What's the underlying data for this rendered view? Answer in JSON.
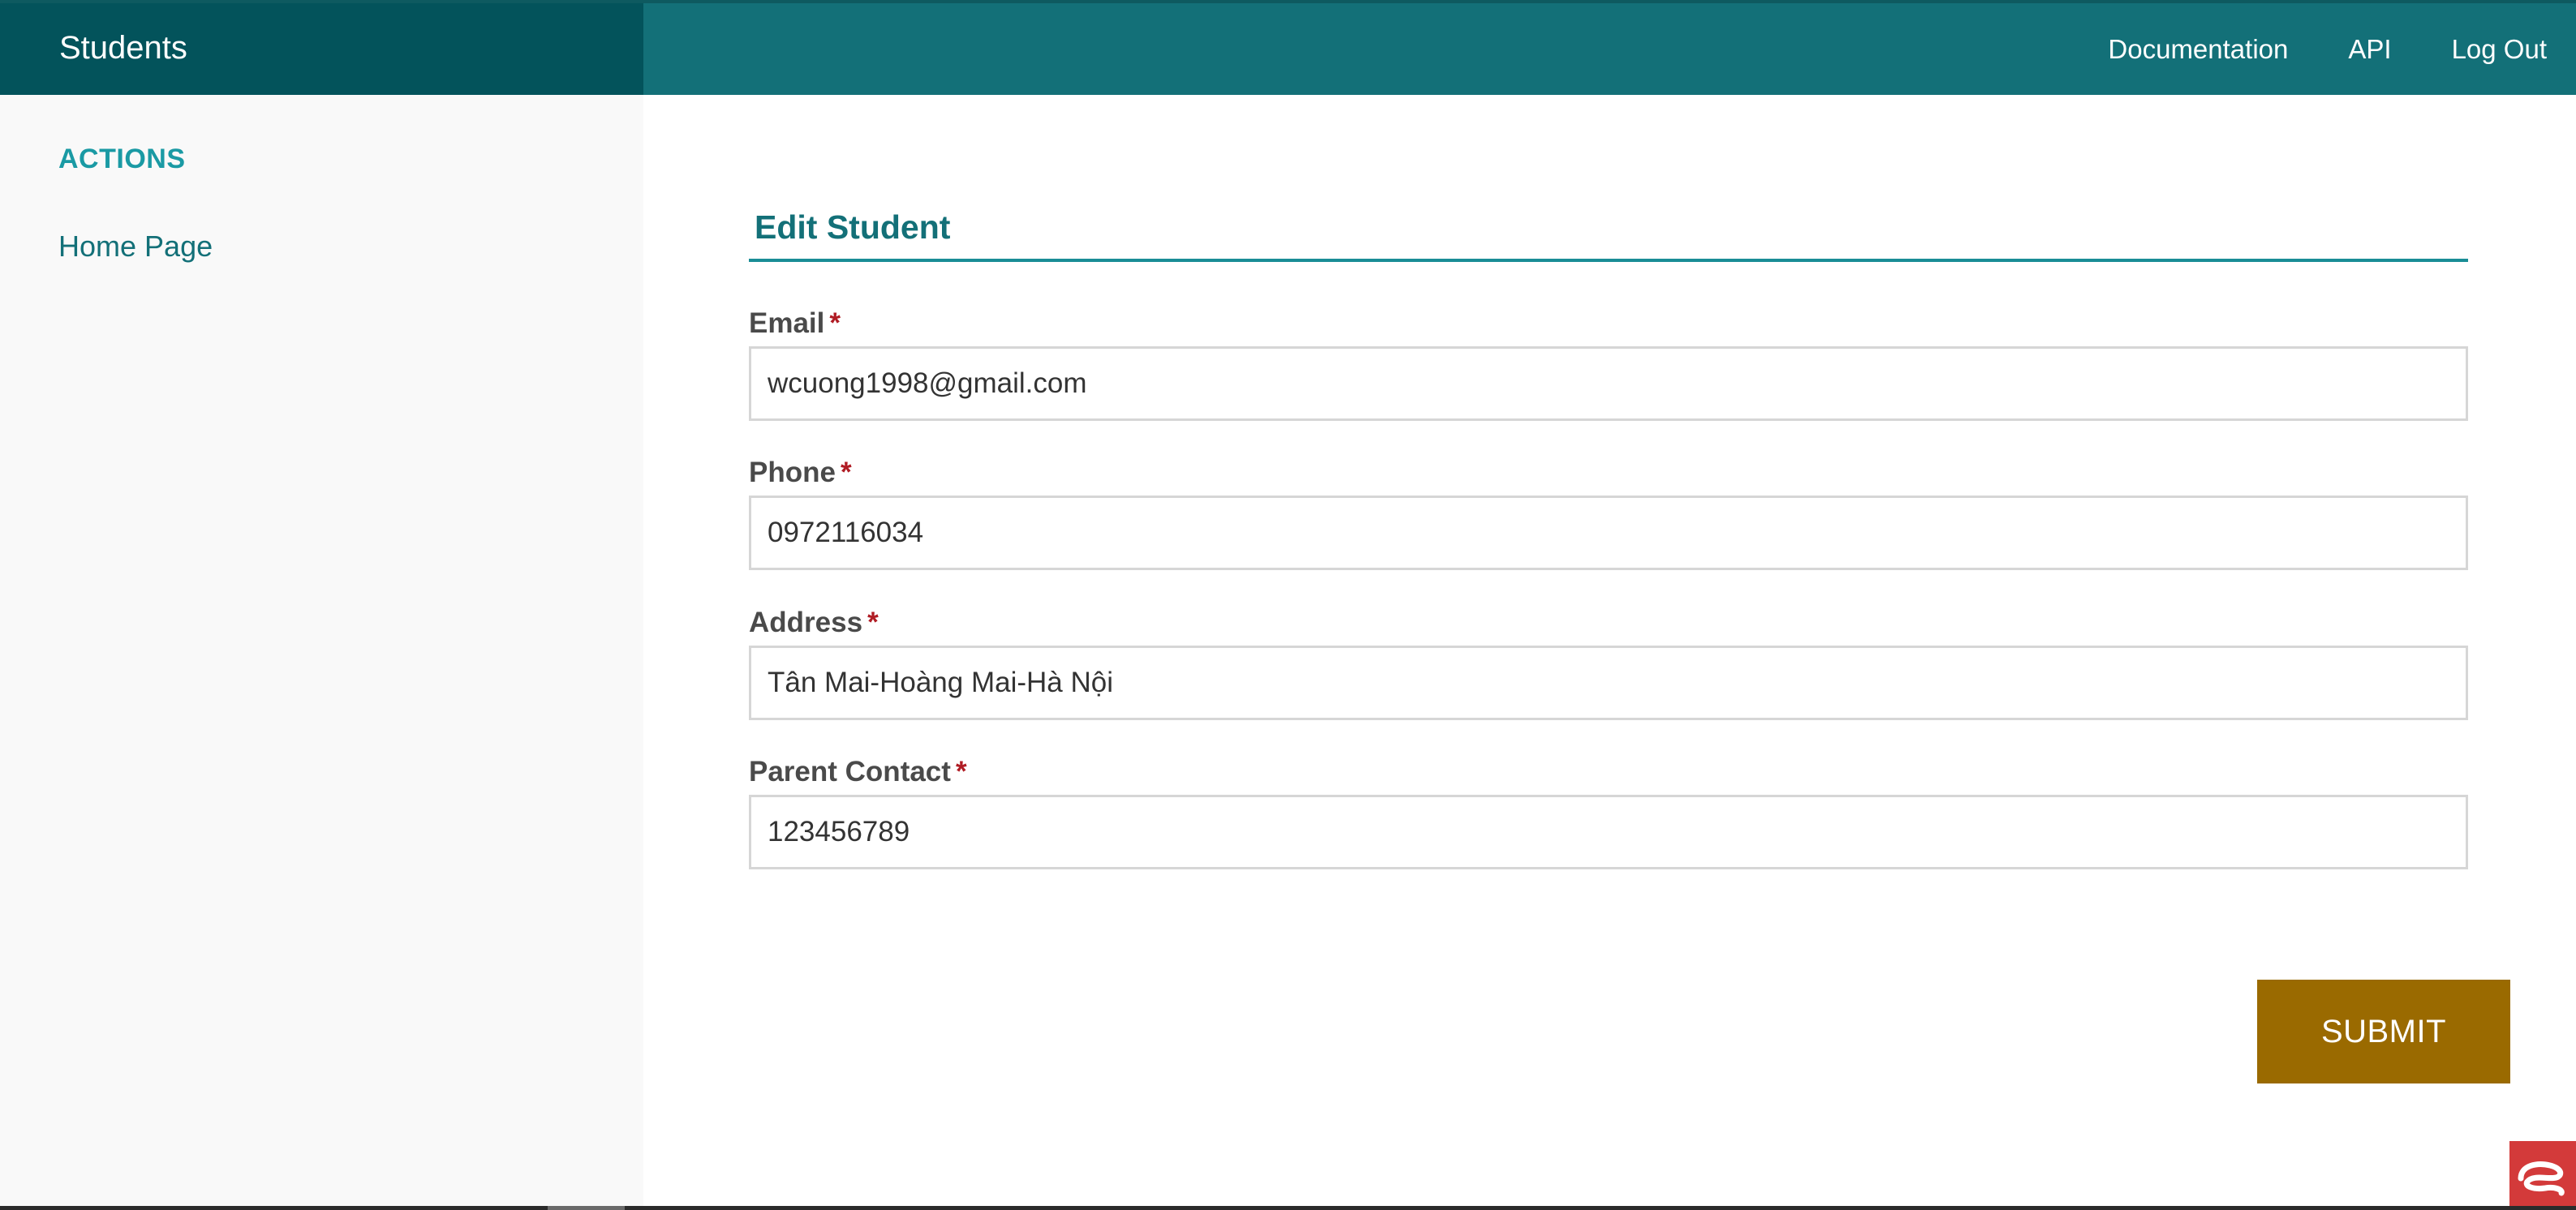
{
  "header": {
    "brand": "Students",
    "nav": [
      {
        "label": "Documentation"
      },
      {
        "label": "API"
      },
      {
        "label": "Log Out"
      }
    ]
  },
  "sidebar": {
    "heading": "ACTIONS",
    "items": [
      {
        "label": "Home Page"
      }
    ]
  },
  "form": {
    "title": "Edit Student",
    "required_marker": "*",
    "fields": [
      {
        "label": "Email",
        "value": "wcuong1998@gmail.com"
      },
      {
        "label": "Phone",
        "value": "0972116034"
      },
      {
        "label": "Address",
        "value": "Tân Mai-Hoàng Mai-Hà Nội"
      },
      {
        "label": "Parent Contact",
        "value": "123456789"
      }
    ],
    "submit_label": "SUBMIT"
  },
  "widgets": {
    "corner_icon": "helper-widget-icon"
  },
  "colors": {
    "topbar": "#137078",
    "brand_bg": "#03535b",
    "accent": "#1a9aa4",
    "submit": "#9a6a00",
    "required": "#b01c24"
  }
}
